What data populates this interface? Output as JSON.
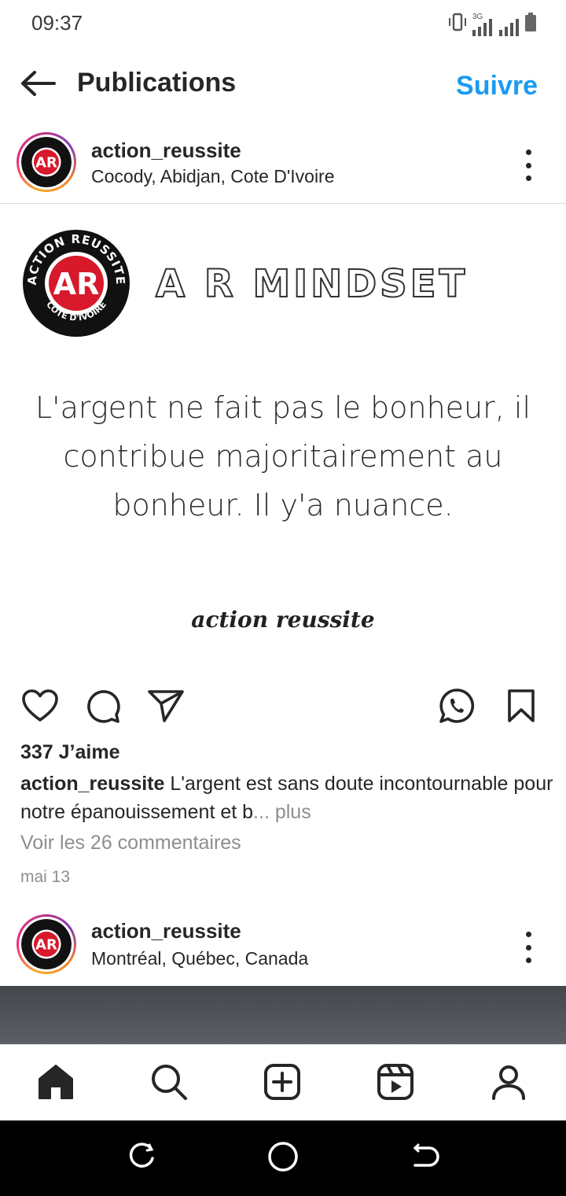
{
  "status_bar": {
    "time": "09:37",
    "network": "3G",
    "icons": [
      "vibrate-icon",
      "signal-icon",
      "battery-icon"
    ]
  },
  "header": {
    "title": "Publications",
    "follow_label": "Suivre",
    "back_icon": "back-arrow-icon"
  },
  "post": {
    "username": "action_reussite",
    "location": "Cocody, Abidjan, Cote D'Ivoire",
    "image": {
      "logo_top_text": "ACTION REUSSITE",
      "logo_monogram": "AR",
      "logo_bottom_text": "CÔTE D'IVOIRE",
      "title": "A R MINDSET",
      "quote": "L'argent ne fait pas le bonheur, il contribue majoritairement au bonheur. Il y'a nuance.",
      "signature": "action reussite"
    },
    "likes": "337 J’aime",
    "caption_user": "action_reussite",
    "caption_text": " L'argent est sans doute incontournable pour notre épanouissement et b",
    "caption_ellipsis": "...",
    "caption_more": " plus",
    "comments_link": "Voir les 26 commentaires",
    "date": "mai 13"
  },
  "next_post": {
    "username": "action_reussite",
    "location": "Montréal, Québec, Canada"
  },
  "bottom_nav": [
    "home-icon",
    "search-icon",
    "create-icon",
    "reels-icon",
    "profile-icon"
  ],
  "colors": {
    "accent": "#1a9bf0",
    "text": "#262626",
    "muted": "#8e8e8e",
    "logo_red": "#d7192b"
  }
}
